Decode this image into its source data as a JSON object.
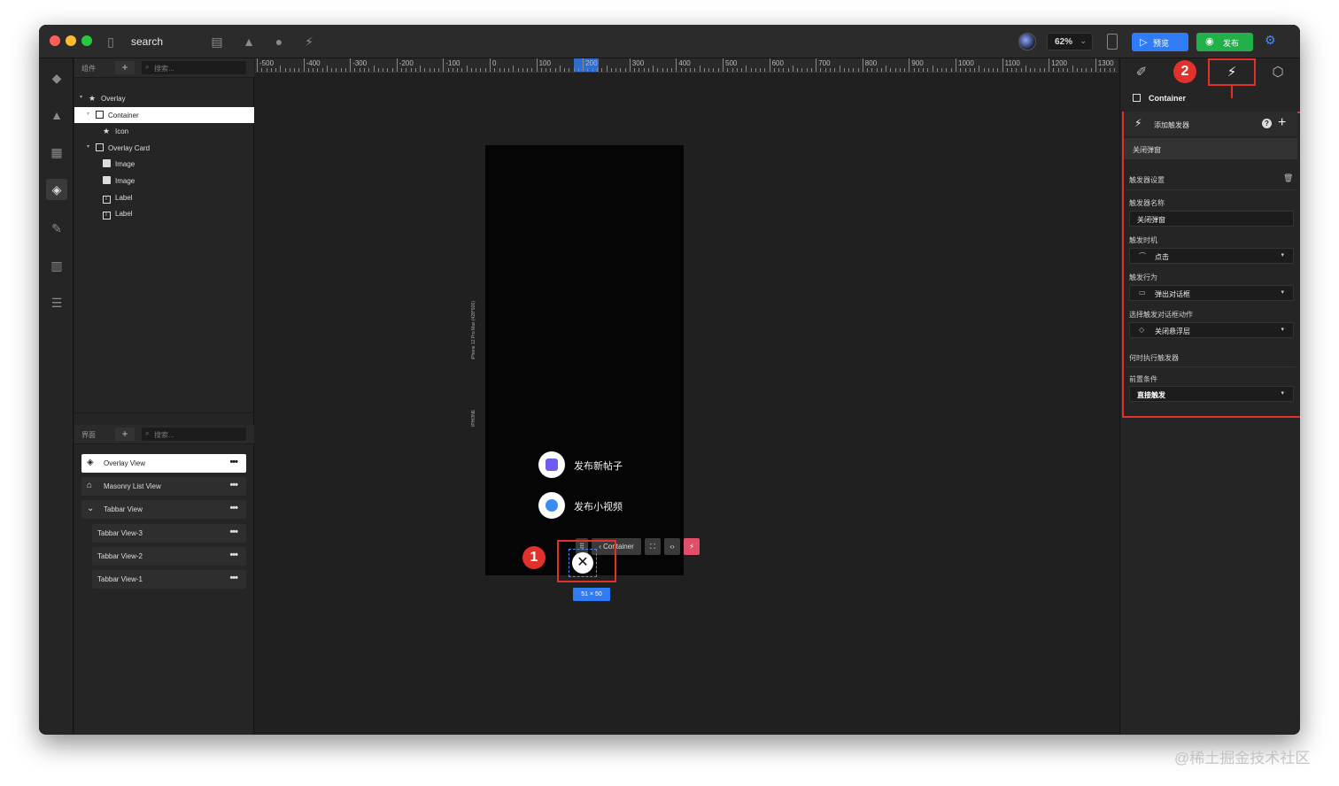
{
  "titlebar": {
    "title": "search",
    "zoom": "62%",
    "preview_label": "预览",
    "publish_label": "发布"
  },
  "left_panel": {
    "components_label": "组件",
    "pages_label": "界面",
    "search_placeholder": "搜索...",
    "tree": [
      {
        "label": "Overlay",
        "icon": "star-icon",
        "level": 0,
        "expanded": true
      },
      {
        "label": "Container",
        "icon": "square-icon",
        "level": 1,
        "expanded": true,
        "selected": true
      },
      {
        "label": "Icon",
        "icon": "star-icon",
        "level": 2
      },
      {
        "label": "Overlay Card",
        "icon": "square-icon",
        "level": 1,
        "expanded": true
      },
      {
        "label": "Image",
        "icon": "image-icon",
        "level": 2
      },
      {
        "label": "Image",
        "icon": "image-icon",
        "level": 2
      },
      {
        "label": "Label",
        "icon": "label-icon",
        "level": 2
      },
      {
        "label": "Label",
        "icon": "label-icon",
        "level": 2
      }
    ],
    "views": [
      {
        "label": "Overlay View",
        "icon": "layers-icon",
        "selected": true
      },
      {
        "label": "Masonry List View",
        "icon": "home-icon"
      },
      {
        "label": "Tabbar View",
        "icon": "chevron-down-icon"
      },
      {
        "label": "Tabbar View-3",
        "indent": true
      },
      {
        "label": "Tabbar View-2",
        "indent": true
      },
      {
        "label": "Tabbar View-1",
        "indent": true
      }
    ]
  },
  "canvas": {
    "ruler_labels": [
      "-500",
      "-400",
      "-300",
      "-200",
      "-100",
      "0",
      "100",
      "200",
      "300",
      "400",
      "500",
      "600",
      "700",
      "800",
      "900",
      "1000",
      "1100",
      "1200",
      "1300"
    ],
    "device_label": "iPhone 12 Pro Max (428*926)",
    "device_type": "IPHONE",
    "menu_items": [
      {
        "label": "发布新帖子",
        "icon": "image-icon",
        "color": "#6e5cf0"
      },
      {
        "label": "发布小视频",
        "icon": "play-icon",
        "color": "#3b8bf5"
      }
    ],
    "context_toolbar": {
      "breadcrumb": "Container"
    },
    "size_chip": "51 × 50",
    "badge_1": "1",
    "badge_2": "2"
  },
  "right_panel": {
    "element_name": "Container",
    "add_trigger_label": "添加触发器",
    "trigger_item": "关闭弹窗",
    "trigger_settings_label": "触发器设置",
    "name_label": "触发器名称",
    "name_value": "关闭弹窗",
    "timing_label": "触发时机",
    "timing_value": "点击",
    "action_label": "触发行为",
    "action_value": "弹出对话框",
    "dialog_action_label": "选择触发对话框动作",
    "dialog_action_value": "关闭悬浮层",
    "when_label": "何时执行触发器",
    "precondition_label": "前置条件",
    "precondition_value": "直接触发"
  },
  "watermark": "@稀土掘金技术社区",
  "colors": {
    "accent_blue": "#2f7cf6",
    "publish_green": "#23b04b",
    "annotation_red": "#e0312b",
    "bolt_pink": "#e04e6a"
  }
}
